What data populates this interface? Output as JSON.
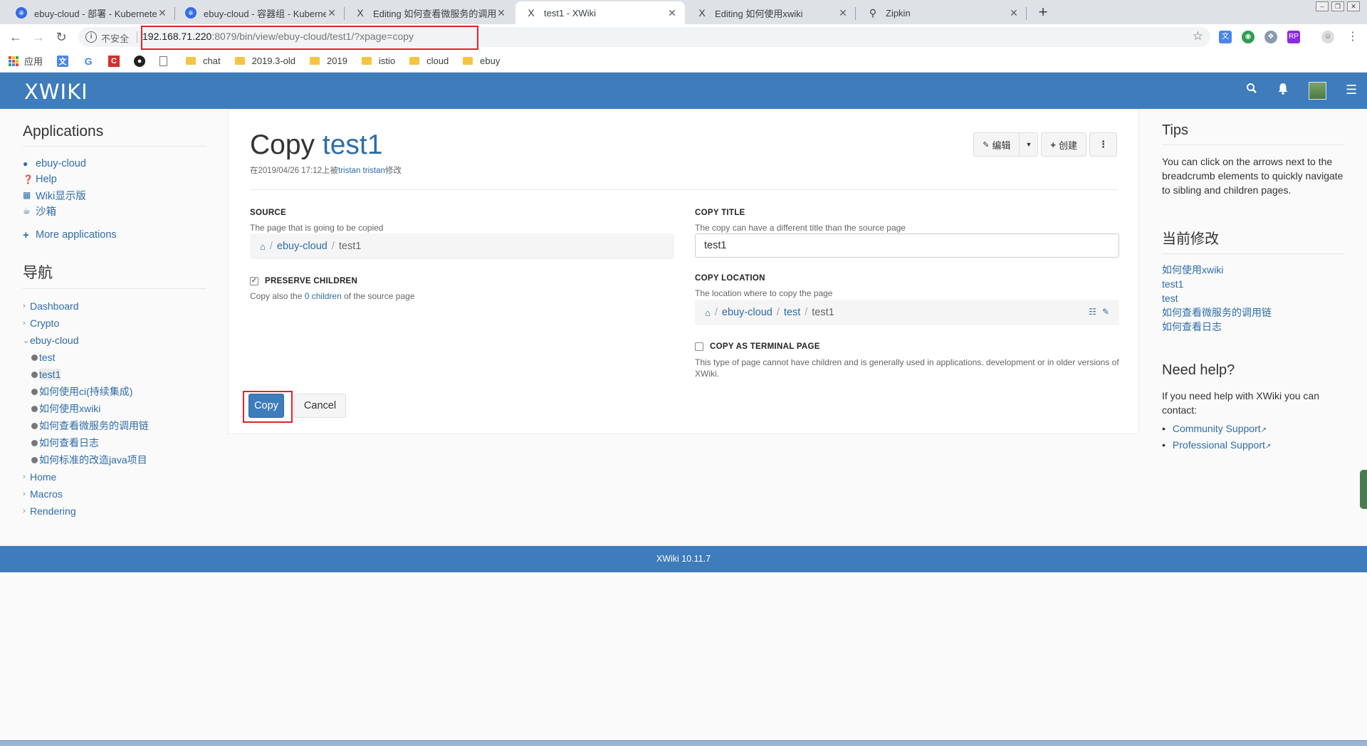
{
  "browser": {
    "tabs": [
      {
        "title": "ebuy-cloud - 部署 - Kubernetes",
        "icon": "kubernetes-icon"
      },
      {
        "title": "ebuy-cloud - 容器组 - Kubernetes",
        "icon": "kubernetes-icon"
      },
      {
        "title": "Editing 如何查看微服务的调用链",
        "icon": "xwiki-icon"
      },
      {
        "title": "test1 - XWiki",
        "icon": "xwiki-icon"
      },
      {
        "title": "Editing 如何使用xwiki",
        "icon": "xwiki-icon"
      },
      {
        "title": "Zipkin",
        "icon": "zipkin-icon"
      }
    ],
    "security_label": "不安全",
    "url_host": "192.168.71.220",
    "url_rest": ":8079/bin/view/ebuy-cloud/test1/?xpage=copy",
    "bookmarks": [
      "应用",
      "chat",
      "2019.3-old",
      "2019",
      "istio",
      "cloud",
      "ebuy"
    ]
  },
  "xwiki": {
    "logo": "XWIKI",
    "left": {
      "apps_title": "Applications",
      "apps": [
        "ebuy-cloud",
        "Help",
        "Wiki显示版",
        "沙箱"
      ],
      "more_apps": "More applications",
      "nav_title": "导航",
      "nav_top1": [
        "Dashboard",
        "Crypto"
      ],
      "nav_expanded": "ebuy-cloud",
      "nav_children": [
        "test",
        "test1",
        "如何使用ci(持续集成)",
        "如何使用xwiki",
        "如何查看微服务的调用链",
        "如何查看日志",
        "如何标准的改造java项目"
      ],
      "nav_top2": [
        "Home",
        "Macros",
        "Rendering"
      ]
    },
    "main": {
      "title_prefix": "Copy",
      "title_name": "test1",
      "meta_before": "在2019/04/26 17:12上被",
      "meta_user": "tristan tristan",
      "meta_after": "修改",
      "edit_label": "编辑",
      "create_label": "创建",
      "source_label": "SOURCE",
      "source_hint": "The page that is going to be copied",
      "source_path": [
        "ebuy-cloud",
        "test1"
      ],
      "preserve_label": "PRESERVE CHILDREN",
      "preserve_checked": true,
      "preserve_hint_before": "Copy also the ",
      "preserve_hint_link": "0 children",
      "preserve_hint_after": " of the source page",
      "copy_title_label": "COPY TITLE",
      "copy_title_hint": "The copy can have a different title than the source page",
      "copy_title_value": "test1",
      "copy_location_label": "COPY LOCATION",
      "copy_location_hint": "The location where to copy the page",
      "copy_location_path": [
        "ebuy-cloud",
        "test",
        "test1"
      ],
      "terminal_label": "COPY AS TERMINAL PAGE",
      "terminal_checked": false,
      "terminal_hint": "This type of page cannot have children and is generally used in applications, development or in older versions of XWiki.",
      "copy_button": "Copy",
      "cancel_button": "Cancel"
    },
    "right": {
      "tips_title": "Tips",
      "tips_text": "You can click on the arrows next to the breadcrumb elements to quickly navigate to sibling and children pages.",
      "recent_title": "当前修改",
      "recent": [
        "如何使用xwiki",
        "test1",
        "test",
        "如何查看微服务的调用链",
        "如何查看日志"
      ],
      "help_title": "Need help?",
      "help_text": "If you need help with XWiki you can contact:",
      "help_links": [
        "Community Support",
        "Professional Support"
      ]
    },
    "footer": "XWiki 10.11.7"
  },
  "colors": {
    "brand": "#3e7cbc",
    "link": "#2f6ca8",
    "highlight": "#e0242c"
  }
}
